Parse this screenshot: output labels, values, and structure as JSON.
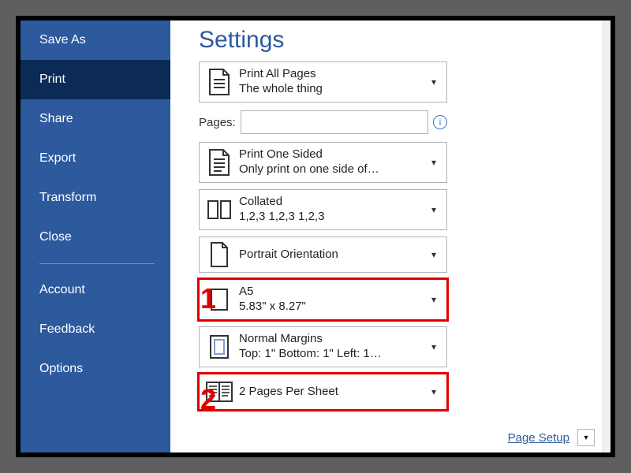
{
  "sidebar": {
    "items": [
      {
        "label": "Save As"
      },
      {
        "label": "Print"
      },
      {
        "label": "Share"
      },
      {
        "label": "Export"
      },
      {
        "label": "Transform"
      },
      {
        "label": "Close"
      }
    ],
    "footer_items": [
      {
        "label": "Account"
      },
      {
        "label": "Feedback"
      },
      {
        "label": "Options"
      }
    ]
  },
  "settings": {
    "heading": "Settings",
    "pages_label": "Pages:",
    "pages_value": "",
    "rows": {
      "print_pages": {
        "title": "Print All Pages",
        "subtitle": "The whole thing"
      },
      "sides": {
        "title": "Print One Sided",
        "subtitle": "Only print on one side of…"
      },
      "collate": {
        "title": "Collated",
        "subtitle": "1,2,3    1,2,3    1,2,3"
      },
      "orientation": {
        "title": "Portrait Orientation"
      },
      "paper": {
        "title": "A5",
        "subtitle": "5.83\" x 8.27\""
      },
      "margins": {
        "title": "Normal Margins",
        "subtitle": "Top: 1\" Bottom: 1\" Left: 1…"
      },
      "per_sheet": {
        "title": "2 Pages Per Sheet"
      }
    },
    "page_setup_link": "Page Setup"
  },
  "annotations": {
    "one": "1",
    "two": "2"
  }
}
